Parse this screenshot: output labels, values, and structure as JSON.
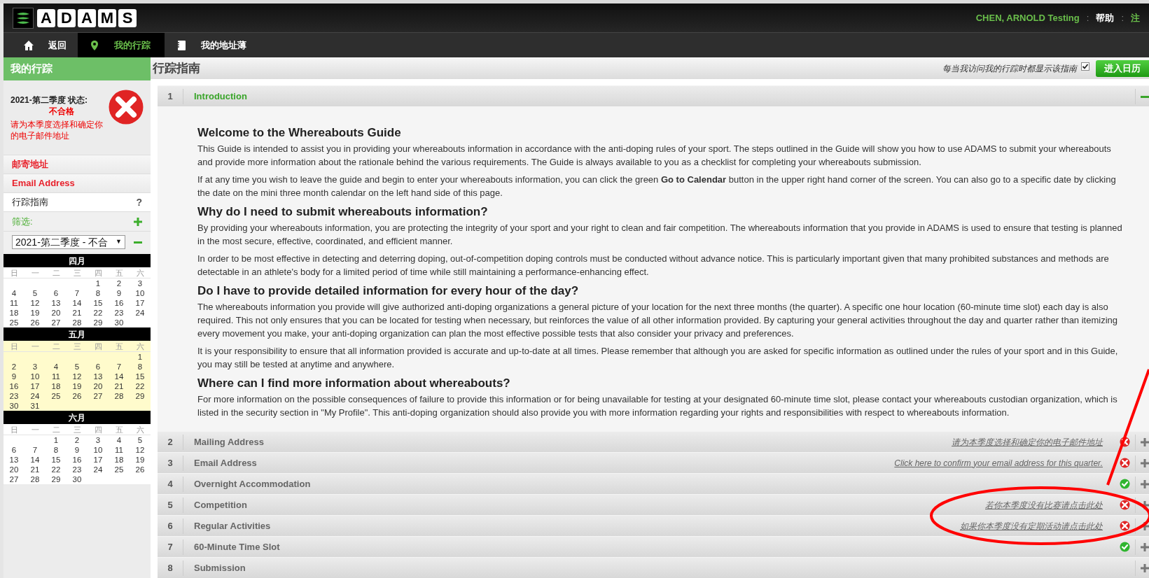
{
  "header": {
    "logo_letters": [
      "A",
      "D",
      "A",
      "M",
      "S"
    ],
    "user": "CHEN, ARNOLD Testing",
    "separator_1": ":",
    "help": "帮助",
    "separator_2": ":",
    "logout": "注"
  },
  "nav_tabs": [
    {
      "kind": "home",
      "label": "返回",
      "selected": false
    },
    {
      "kind": "pin",
      "label": "我的行踪",
      "selected": true
    },
    {
      "kind": "book",
      "label": "我的地址薄",
      "selected": false
    }
  ],
  "sidebar": {
    "title": "我的行踪",
    "status": {
      "label": "2021-第二季度 状态:",
      "value": "不合格",
      "message": "请为本季度选择和确定你的电子邮件地址",
      "ok": false
    },
    "links": [
      {
        "label": "邮寄地址",
        "error": true
      },
      {
        "label": "Email Address",
        "error": true
      },
      {
        "label": "行踪指南",
        "error": false,
        "help": "?"
      }
    ],
    "filter": {
      "label": "筛选:",
      "expanded": false
    },
    "quarter_select": {
      "value": "2021-第二季度 - 不合",
      "arrow": "▼",
      "expanded": true
    },
    "calendar": [
      {
        "title": "四月",
        "highlighted": false,
        "weekdays": [
          "日",
          "一",
          "二",
          "三",
          "四",
          "五",
          "六"
        ],
        "weeks": [
          [
            "1",
            "2",
            "3"
          ],
          [
            "4",
            "5",
            "6",
            "7",
            "8",
            "9",
            "10"
          ],
          [
            "11",
            "12",
            "13",
            "14",
            "15",
            "16",
            "17"
          ],
          [
            "18",
            "19",
            "20",
            "21",
            "22",
            "23",
            "24"
          ],
          [
            "25",
            "26",
            "27",
            "28",
            "29",
            "30"
          ]
        ]
      },
      {
        "title": "五月",
        "highlighted": true,
        "weekdays": [
          "日",
          "一",
          "二",
          "三",
          "四",
          "五",
          "六"
        ],
        "weeks": [
          [
            "1"
          ],
          [
            "2",
            "3",
            "4",
            "5",
            "6",
            "7",
            "8"
          ],
          [
            "9",
            "10",
            "11",
            "12",
            "13",
            "14",
            "15"
          ],
          [
            "16",
            "17",
            "18",
            "19",
            "20",
            "21",
            "22"
          ],
          [
            "23",
            "24",
            "25",
            "26",
            "27",
            "28",
            "29"
          ],
          [
            "30",
            "31"
          ]
        ]
      },
      {
        "title": "六月",
        "highlighted": false,
        "weekdays": [
          "日",
          "一",
          "二",
          "三",
          "四",
          "五",
          "六"
        ],
        "weeks": [
          [
            "1",
            "2",
            "3",
            "4",
            "5"
          ],
          [
            "6",
            "7",
            "8",
            "9",
            "10",
            "11",
            "12"
          ],
          [
            "13",
            "14",
            "15",
            "16",
            "17",
            "18",
            "19"
          ],
          [
            "20",
            "21",
            "22",
            "23",
            "24",
            "25",
            "26"
          ],
          [
            "27",
            "28",
            "29",
            "30"
          ]
        ]
      }
    ]
  },
  "main": {
    "title": "行踪指南",
    "show_guide": {
      "label": "每当我访问我的行踪时都显示该指南",
      "checked": true
    },
    "calendar_button": "进入日历",
    "sections": [
      {
        "number": "1",
        "title": "Introduction",
        "expanded": true,
        "content": [
          {
            "kind": "heading",
            "text": "Welcome to the Whereabouts Guide"
          },
          {
            "kind": "paragraph",
            "text": "This Guide is intended to assist you in providing your whereabouts information in accordance with the anti-doping rules of your sport. The steps outlined in the Guide will show you how to use ADAMS to submit your whereabouts and provide more information about the rationale behind the various requirements. The Guide is always available to you as a checklist for completing your whereabouts submission."
          },
          {
            "kind": "paragraph",
            "text": "If at any time you wish to leave the guide and begin to enter your whereabouts information, you can click the green **Go to Calendar** button in the upper right hand corner of the screen. You can also go to a specific date by clicking the date on the mini three month calendar on the left hand side of this page."
          },
          {
            "kind": "heading",
            "text": "Why do I need to submit whereabouts information?"
          },
          {
            "kind": "paragraph",
            "text": "By providing your whereabouts information, you are protecting the integrity of your sport and your right to clean and fair competition. The whereabouts information that you provide in ADAMS is used to ensure that testing is planned in the most secure, effective, coordinated, and efficient manner."
          },
          {
            "kind": "paragraph",
            "text": "In order to be most effective in detecting and deterring doping, out-of-competition doping controls must be conducted without advance notice. This is particularly important given that many prohibited substances and methods are detectable in an athlete's body for a limited period of time while still maintaining a performance-enhancing effect."
          },
          {
            "kind": "heading",
            "text": "Do I have to provide detailed information for every hour of the day?"
          },
          {
            "kind": "paragraph",
            "text": "The whereabouts information you provide will give authorized anti-doping organizations a general picture of your location for the next three months (the quarter). A specific one hour location (60-minute time slot) each day is also required. This not only ensures that you can be located for testing when necessary, but reinforces the value of all other information provided. By capturing your general activities throughout the day and quarter rather than itemizing every movement you make, your anti-doping organization can plan the most effective possible tests that also consider your privacy and preferences."
          },
          {
            "kind": "paragraph",
            "text": "It is your responsibility to ensure that all information provided is accurate and up-to-date at all times. Please remember that although you are asked for specific information as outlined under the rules of your sport and in this Guide, you may still be tested at anytime and anywhere."
          },
          {
            "kind": "heading",
            "text": "Where can I find more information about whereabouts?"
          },
          {
            "kind": "paragraph",
            "text": "For more information on the possible consequences of failure to provide this information or for being unavailable for testing at your designated 60-minute time slot, please contact your whereabouts custodian organization, which is listed in the security section in \"My Profile\". This anti-doping organization should also provide you with more information regarding your rights and responsibilities with respect to whereabouts information."
          }
        ]
      },
      {
        "number": "2",
        "title": "Mailing Address",
        "link": "请为本季度选择和确定你的电子邮件地址",
        "complete": false,
        "expanded": false
      },
      {
        "number": "3",
        "title": "Email Address",
        "link": "Click here to confirm your email address for this quarter.",
        "complete": false,
        "expanded": false
      },
      {
        "number": "4",
        "title": "Overnight Accommodation",
        "complete": true,
        "expanded": false
      },
      {
        "number": "5",
        "title": "Competition",
        "link": "若你本季度没有比赛请点击此处",
        "complete": false,
        "expanded": false
      },
      {
        "number": "6",
        "title": "Regular Activities",
        "link": "如果你本季度没有定期活动请点击此处",
        "complete": false,
        "expanded": false
      },
      {
        "number": "7",
        "title": "60-Minute Time Slot",
        "complete": true,
        "expanded": false
      },
      {
        "number": "8",
        "title": "Submission",
        "expanded": false
      }
    ]
  }
}
